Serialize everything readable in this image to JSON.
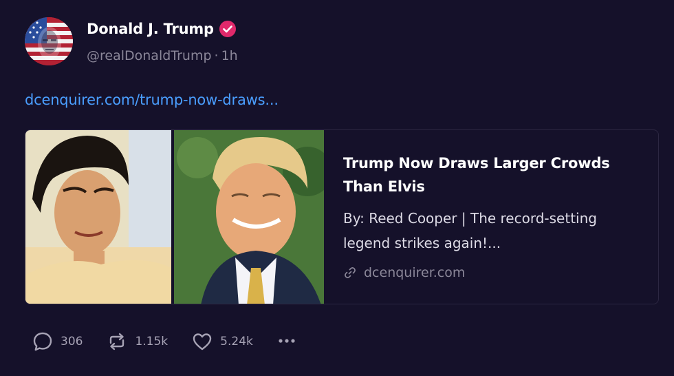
{
  "author": {
    "display_name": "Donald J. Trump",
    "handle": "@realDonaldTrump",
    "separator": "·",
    "time_ago": "1h",
    "avatar_icon": "flag-portrait-avatar",
    "verified_icon": "verified-badge-icon",
    "verified_color": "#e0296b"
  },
  "post": {
    "link_text": "dcenquirer.com/trump-now-draws..."
  },
  "card": {
    "title": "Trump Now Draws Larger Crowds Than Elvis",
    "description": "By: Reed Cooper | The record-setting legend strikes again!...",
    "domain": "dcenquirer.com",
    "domain_icon": "link-icon"
  },
  "actions": {
    "replies": "306",
    "reposts": "1.15k",
    "likes": "5.24k",
    "reply_icon": "comment-icon",
    "repost_icon": "repost-icon",
    "like_icon": "heart-icon",
    "more_icon": "more-icon"
  },
  "colors": {
    "background": "#15112a",
    "link": "#4a9eff",
    "muted": "#8b8799",
    "card_border": "#2c2742"
  }
}
